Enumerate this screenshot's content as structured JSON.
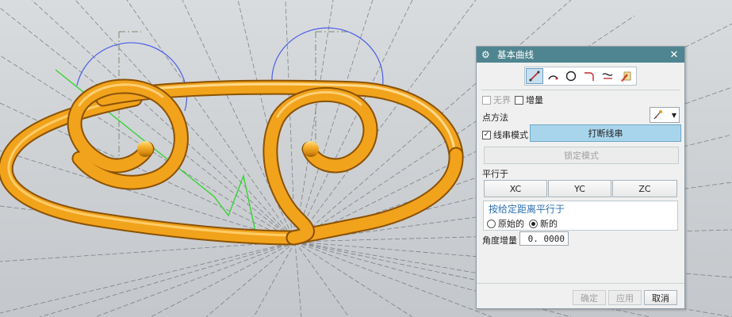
{
  "dialog": {
    "title": "基本曲线",
    "tools": [
      "line-tool-icon",
      "arc-tool-icon",
      "circle-tool-icon",
      "fillet-tool-icon",
      "trim-tool-icon",
      "edit-tool-icon"
    ],
    "unbounded_label": "无界",
    "incremental_label": "增量",
    "point_method_label": "点方法",
    "string_mode_label": "线串模式",
    "break_string_label": "打断线串",
    "lock_mode_label": "锁定模式",
    "parallel_to_label": "平行于",
    "axis_buttons": [
      "XC",
      "YC",
      "ZC"
    ],
    "offset_group_title": "按给定距离平行于",
    "radio_original": "原始的",
    "radio_new": "新的",
    "angle_increment_label": "角度增量",
    "angle_increment_value": "0. 0000",
    "ok_label": "确定",
    "apply_label": "应用",
    "cancel_label": "取消"
  },
  "colors": {
    "title_bar": "#4f8590",
    "tube": "#f2a31c",
    "construction_circle": "#4a5ee8",
    "construction_line": "#35d435"
  }
}
